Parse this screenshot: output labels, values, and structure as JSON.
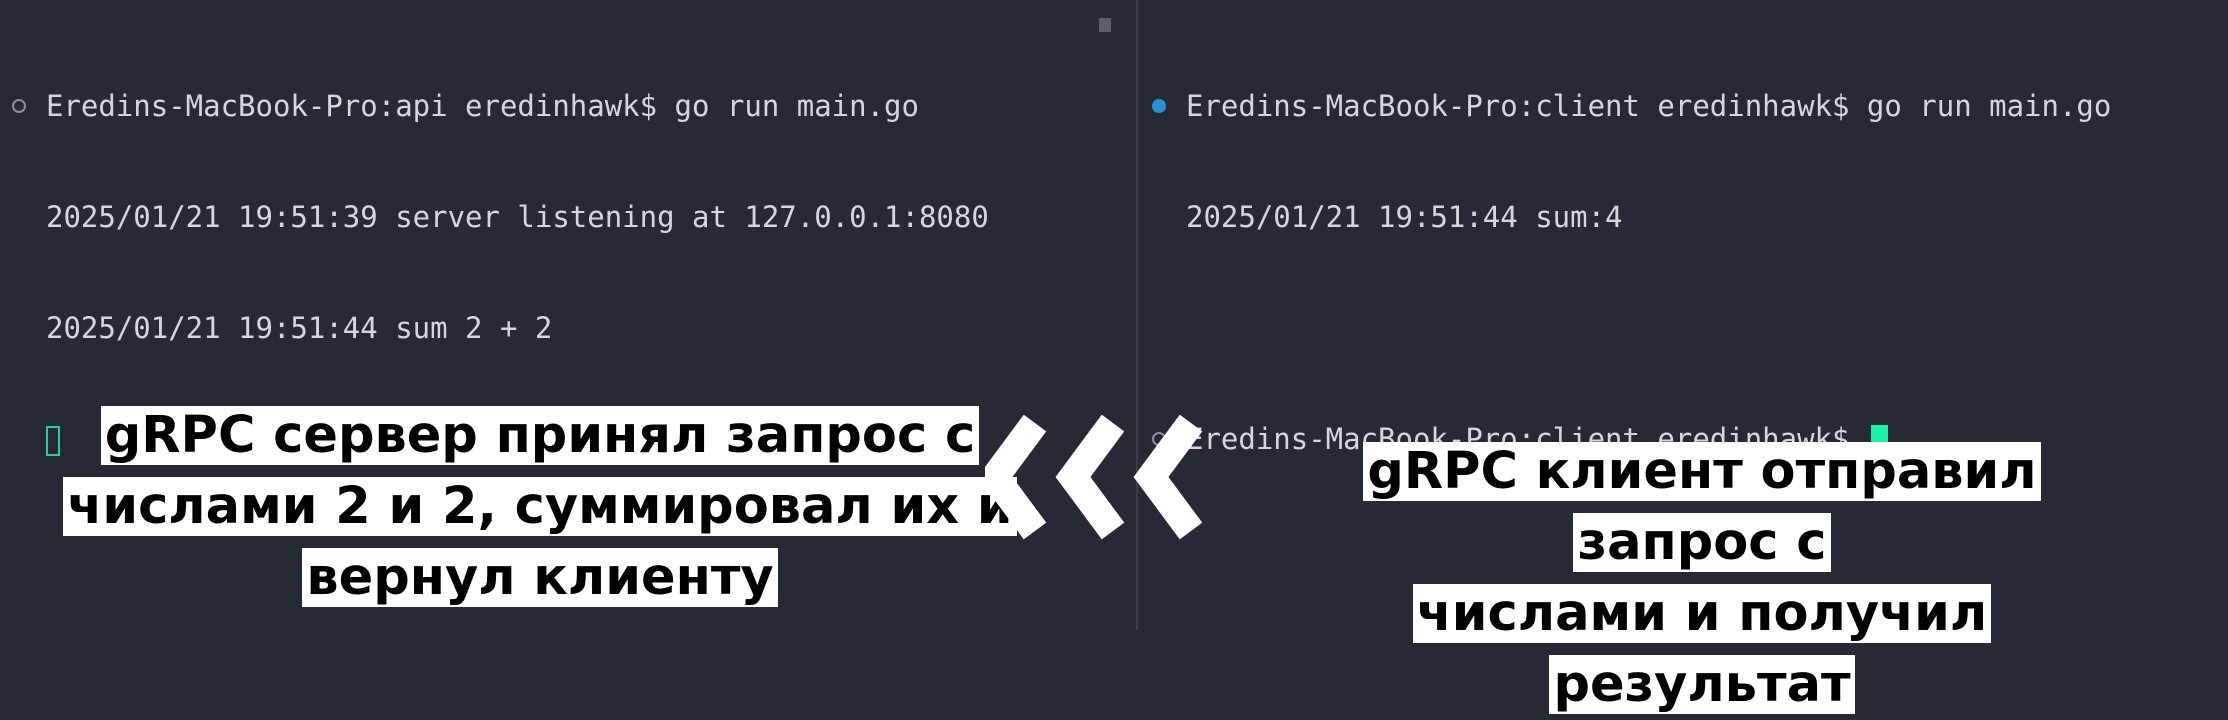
{
  "left_pane": {
    "lines": [
      "Eredins-MacBook-Pro:api eredinhawk$ go run main.go",
      "2025/01/21 19:51:39 server listening at 127.0.0.1:8080",
      "2025/01/21 19:51:44 sum 2 + 2"
    ]
  },
  "right_pane": {
    "lines": [
      "Eredins-MacBook-Pro:client eredinhawk$ go run main.go",
      "2025/01/21 19:51:44 sum:4",
      "",
      "Eredins-MacBook-Pro:client eredinhawk$ "
    ]
  },
  "captions": {
    "left_line1": "gRPC сервер принял запрос с",
    "left_line2": "числами 2 и 2, суммировал их и",
    "left_line3": "вернул клиенту",
    "right_line1": "gRPC клиент отправил запрос с",
    "right_line2": "числами и получил результат"
  },
  "colors": {
    "background": "#262a34",
    "text": "#d4d7de",
    "cursor": "#1ff0a8",
    "status_dot": "#2e8fd1"
  },
  "icons": [
    "chevron-left-icon"
  ]
}
